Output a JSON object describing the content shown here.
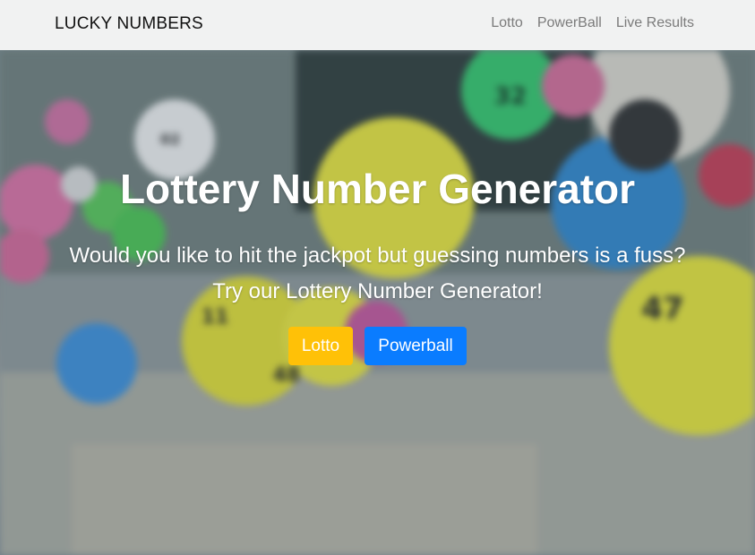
{
  "navbar": {
    "brand": "LUCKY NUMBERS",
    "links": [
      {
        "label": "Lotto"
      },
      {
        "label": "PowerBall"
      },
      {
        "label": "Live Results"
      }
    ]
  },
  "hero": {
    "title": "Lottery Number Generator",
    "line1": "Would you like to hit the jackpot but guessing numbers is a fuss?",
    "line2": "Try our Lottery Number Generator!",
    "buttons": {
      "lotto": "Lotto",
      "powerball": "Powerball"
    },
    "background_icon": "lottery-balls-photo"
  },
  "colors": {
    "navbar_bg": "#f1f2f2",
    "lotto_button": "#ffc107",
    "powerball_button": "#0a7cff"
  }
}
